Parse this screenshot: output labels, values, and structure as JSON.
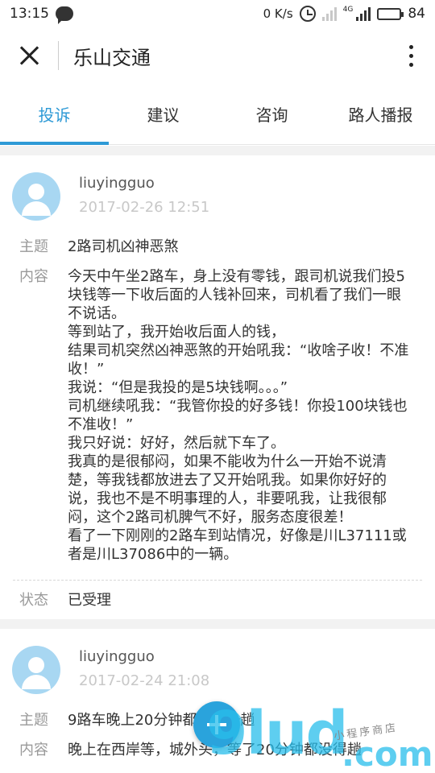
{
  "status_bar": {
    "time": "13:15",
    "speed": "0 K/s",
    "network_type": "4G",
    "battery": "84",
    "battery_level": 0.84
  },
  "header": {
    "title": "乐山交通"
  },
  "tabs": [
    {
      "label": "投诉",
      "active": true
    },
    {
      "label": "建议",
      "active": false
    },
    {
      "label": "咨询",
      "active": false
    },
    {
      "label": "路人播报",
      "active": false
    }
  ],
  "labels": {
    "subject": "主题",
    "content": "内容",
    "status": "状态"
  },
  "posts": [
    {
      "user": "liuyingguo",
      "time": "2017-02-26 12:51",
      "subject": "2路司机凶神恶煞",
      "content": "今天中午坐2路车，身上没有零钱，跟司机说我们投5块钱等一下收后面的人钱补回来，司机看了我们一眼不说话。\n等到站了，我开始收后面人的钱，\n结果司机突然凶神恶煞的开始吼我：“收啥子收！不准收！”\n我说：“但是我投的是5块钱啊。。。”\n司机继续吼我：“我管你投的好多钱！你投100块钱也不准收！”\n我只好说：好好，然后就下车了。\n我真的是很郁闷，如果不能收为什么一开始不说清楚，等我钱都放进去了又开始吼我。如果你好好的说，我也不是不明事理的人，非要吼我，让我很郁闷，这个2路司机脾气不好，服务态度很差！\n看了一下刚刚的2路车到站情况，好像是川L37111或者是川L37086中的一辆。",
      "status": "已受理"
    },
    {
      "user": "liuyingguo",
      "time": "2017-02-24 21:08",
      "subject": "9路车晚上20分钟都没得一趟",
      "content": "晚上在西岸等，城外头，等了20分钟都没得趟"
    }
  ],
  "watermark": {
    "brand": "9lud",
    "domain": ".com",
    "small": "小程序商店"
  }
}
